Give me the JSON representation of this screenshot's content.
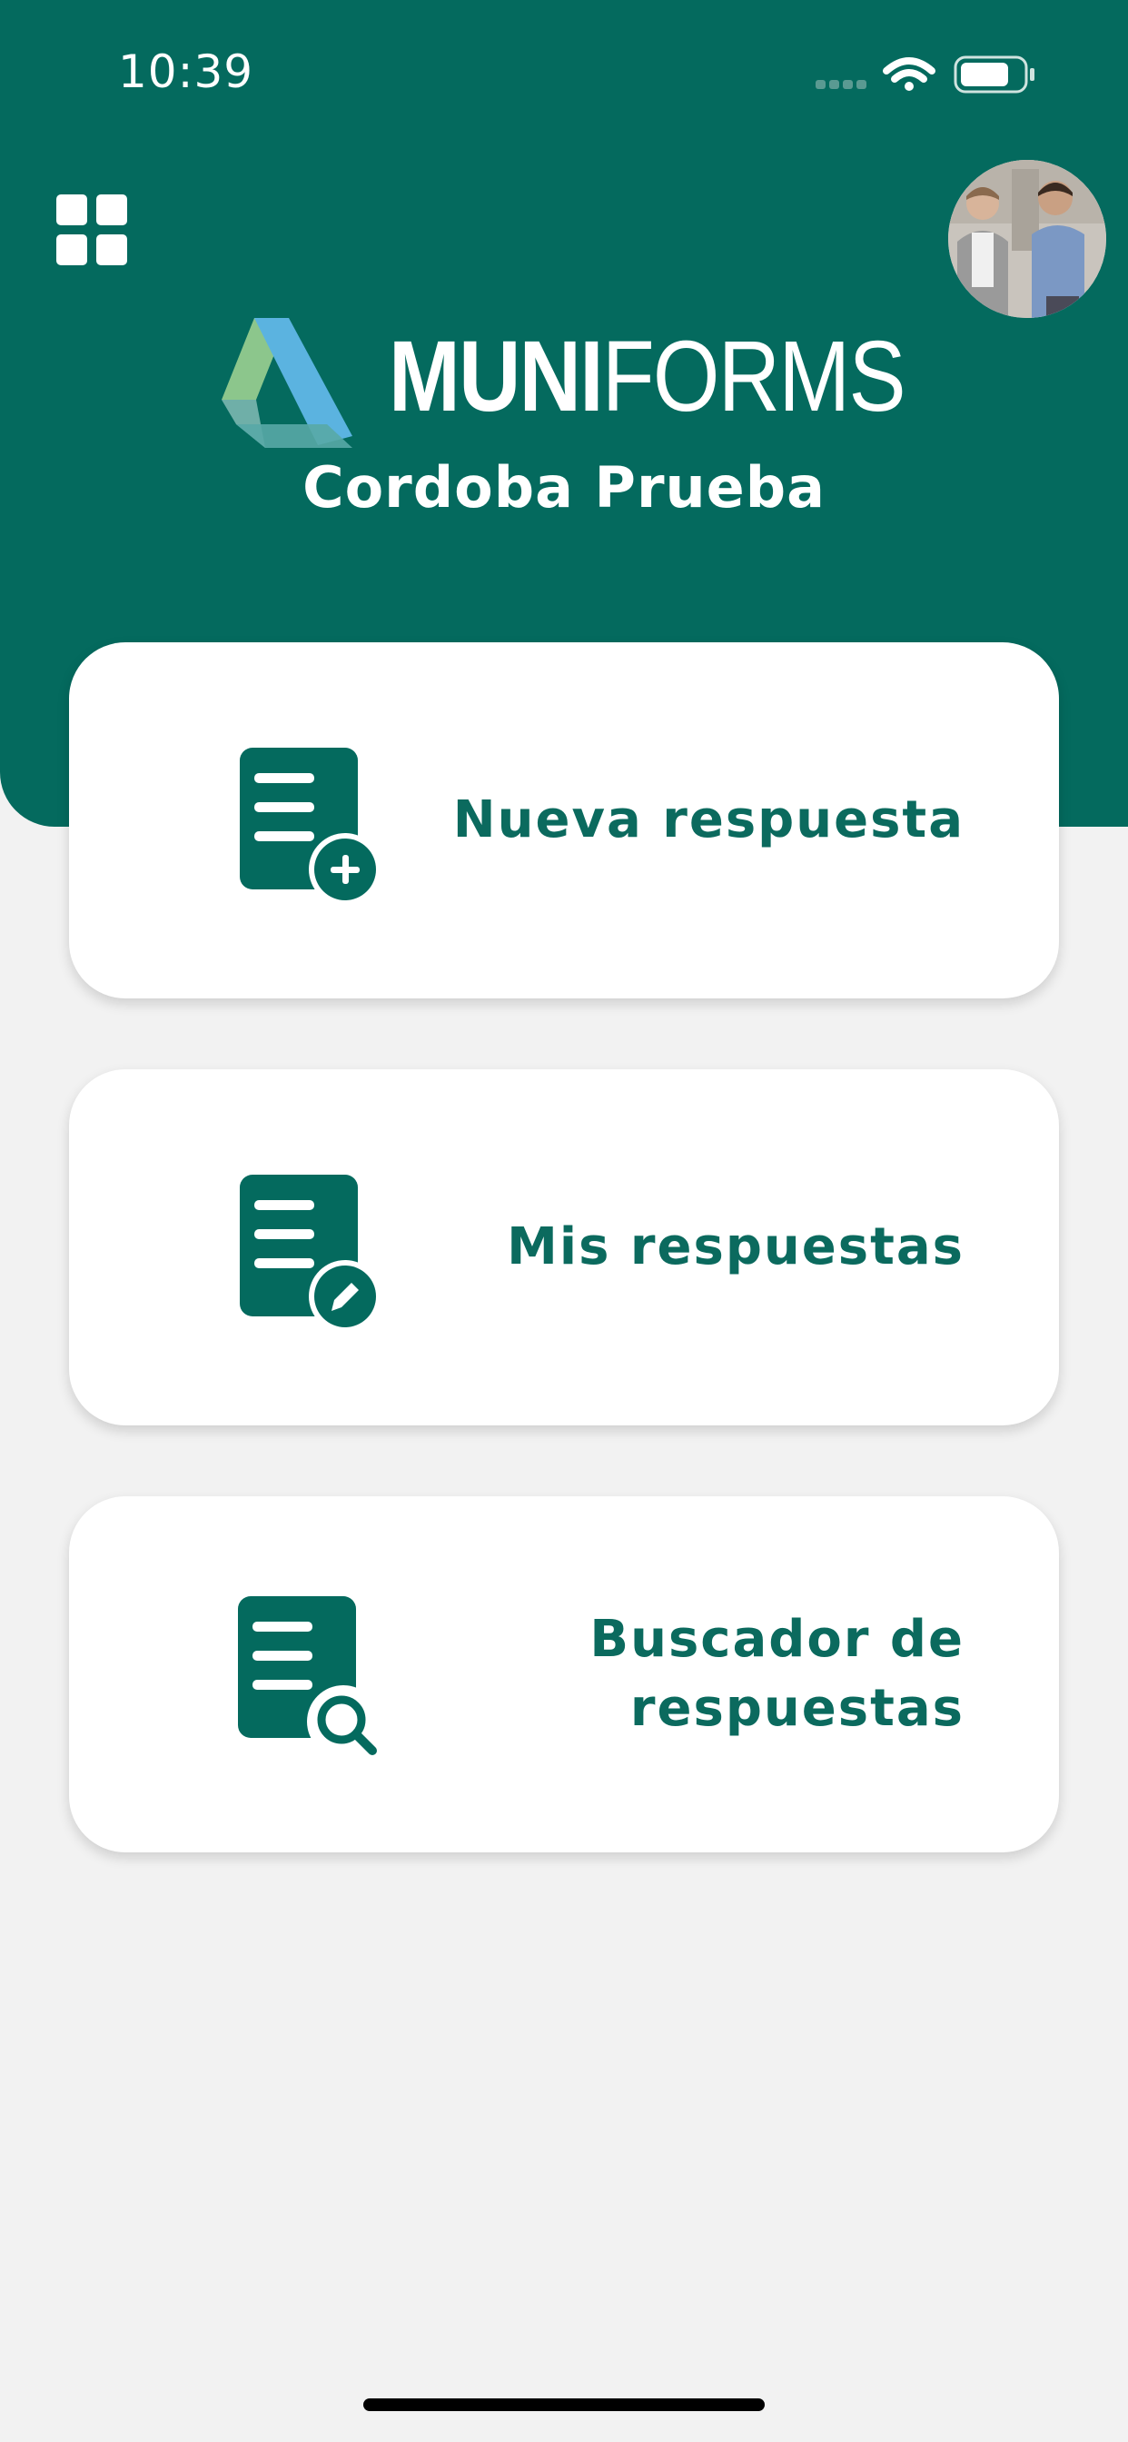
{
  "status_bar": {
    "time": "10:39",
    "signal_icon": "cellular-signal-icon",
    "wifi_icon": "wifi-icon",
    "battery_icon": "battery-icon"
  },
  "header": {
    "menu_icon": "apps-grid-icon",
    "avatar": "profile-avatar",
    "brand": {
      "bold": "MUNI",
      "light": "FORMS"
    },
    "organization": "Cordoba Prueba",
    "color": "#046A5E"
  },
  "cards": [
    {
      "label": "Nueva respuesta",
      "icon": "document-add-icon"
    },
    {
      "label": "Mis respuestas",
      "icon": "document-edit-icon"
    },
    {
      "label": "Buscador de respuestas",
      "icon": "document-search-icon"
    }
  ],
  "colors": {
    "primary": "#046A5E",
    "background": "#F2F2F2",
    "card": "#FFFFFF",
    "logo_green": "#8CC68C",
    "logo_blue": "#5BB3E0"
  }
}
